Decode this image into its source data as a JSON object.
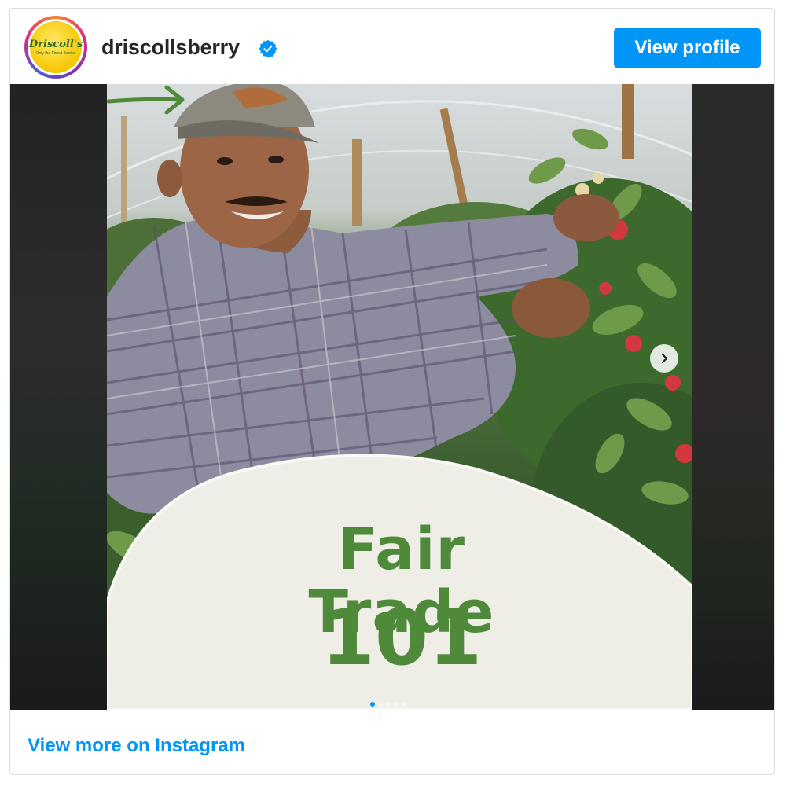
{
  "header": {
    "avatar_logo": "Driscoll's",
    "avatar_tagline": "Only the Finest Berries",
    "username": "driscollsberry",
    "verified": true,
    "view_profile_label": "View profile"
  },
  "post": {
    "overlay_line1": "Fair Trade",
    "overlay_line2": "101",
    "carousel_slides": 5,
    "active_slide": 1
  },
  "footer": {
    "link_label": "View more on Instagram"
  },
  "colors": {
    "primary_blue": "#0095f6",
    "overlay_green": "#4f8a3b"
  },
  "icons": [
    "verified-badge-icon",
    "chevron-right-icon",
    "arrow-right-icon"
  ]
}
